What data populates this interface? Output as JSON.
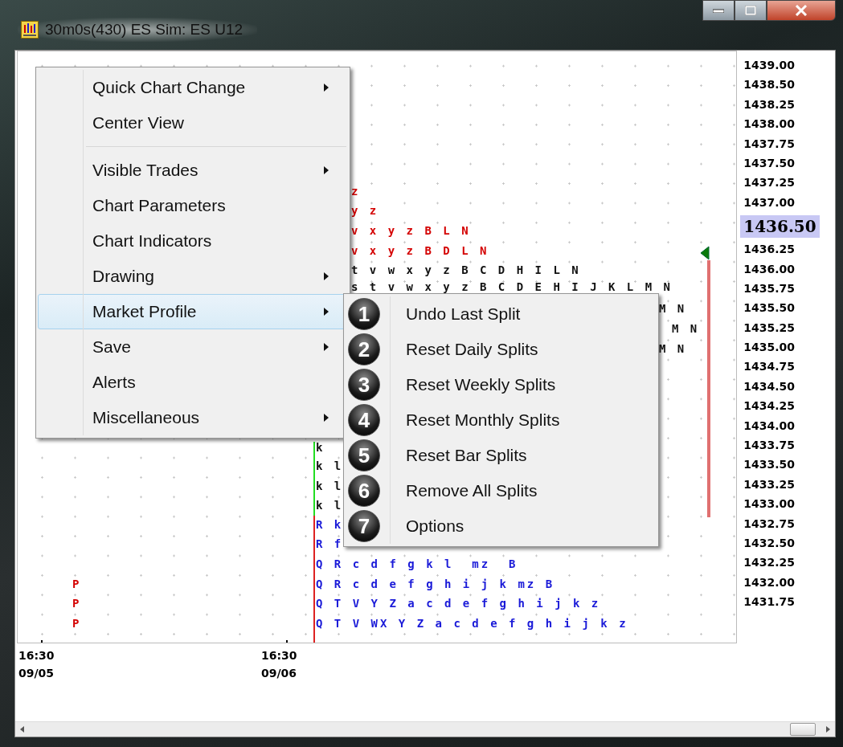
{
  "window": {
    "title": "30m0s(430) ES Sim: ES U12"
  },
  "profile_rows": [
    {
      "text": "z",
      "color": "#d40000"
    },
    {
      "text": "y z",
      "color": "#d40000"
    },
    {
      "text": "v x y z B L N",
      "color": "#d40000"
    },
    {
      "text": "v x y z B D L N",
      "color": "#d40000"
    },
    {
      "text": "t v w x y z B C D H I L N",
      "color": "#111111"
    },
    {
      "text": "s t v w x y z B C D E H I J K L M N",
      "color": "#111111"
    },
    {
      "text": "M N",
      "color": "#111111"
    },
    {
      "text": "M N",
      "color": "#111111"
    },
    {
      "text": "M N",
      "color": "#111111"
    },
    {
      "text": "k",
      "color": "#111111"
    },
    {
      "text": "k l",
      "color": "#111111"
    },
    {
      "text": "k l",
      "color": "#111111"
    },
    {
      "text": "k l",
      "color": "#111111"
    },
    {
      "text": "R k",
      "color": "#1a1ad8"
    },
    {
      "text": "R f",
      "color": "#1a1ad8"
    },
    {
      "text": "Q R c d f g k l  mz  B",
      "color": "#1a1ad8"
    },
    {
      "text": "Q R c d e f g h i j k mz B",
      "color": "#1a1ad8"
    },
    {
      "text": "Q T V Y Z a c d e f g h i j k z",
      "color": "#1a1ad8"
    },
    {
      "text": "Q T V WX Y Z a c d e f g h i j k z",
      "color": "#1a1ad8"
    },
    {
      "text": "P",
      "color": "#d40000"
    },
    {
      "text": "P",
      "color": "#d40000"
    },
    {
      "text": "P",
      "color": "#d40000"
    }
  ],
  "price_axis": [
    {
      "kind": "tick",
      "label": "1439.00"
    },
    {
      "kind": "tick",
      "label": "1438.50"
    },
    {
      "kind": "tick",
      "label": "1438.25"
    },
    {
      "kind": "tick",
      "label": "1438.00"
    },
    {
      "kind": "tick",
      "label": "1437.75"
    },
    {
      "kind": "tick",
      "label": "1437.50"
    },
    {
      "kind": "tick",
      "label": "1437.25"
    },
    {
      "kind": "tick",
      "label": "1437.00"
    },
    {
      "kind": "current",
      "label": "1436.50"
    },
    {
      "kind": "tick",
      "label": "1436.25"
    },
    {
      "kind": "tick",
      "label": "1436.00"
    },
    {
      "kind": "tick",
      "label": "1435.75"
    },
    {
      "kind": "tick",
      "label": "1435.50"
    },
    {
      "kind": "tick",
      "label": "1435.25"
    },
    {
      "kind": "tick",
      "label": "1435.00"
    },
    {
      "kind": "tick",
      "label": "1434.75"
    },
    {
      "kind": "tick",
      "label": "1434.50"
    },
    {
      "kind": "tick",
      "label": "1434.25"
    },
    {
      "kind": "tick",
      "label": "1434.00"
    },
    {
      "kind": "tick",
      "label": "1433.75"
    },
    {
      "kind": "tick",
      "label": "1433.50"
    },
    {
      "kind": "tick",
      "label": "1433.25"
    },
    {
      "kind": "tick",
      "label": "1433.00"
    },
    {
      "kind": "tick",
      "label": "1432.75"
    },
    {
      "kind": "tick",
      "label": "1432.50"
    },
    {
      "kind": "tick",
      "label": "1432.25"
    },
    {
      "kind": "tick",
      "label": "1432.00"
    },
    {
      "kind": "tick",
      "label": "1431.75"
    }
  ],
  "time_axis": [
    {
      "time": "16:30",
      "date": "09/05"
    },
    {
      "time": "16:30",
      "date": "09/06"
    }
  ],
  "context_menu": [
    {
      "kind": "item",
      "label": "Quick Chart Change",
      "has_submenu": true,
      "selected": false
    },
    {
      "kind": "item",
      "label": "Center View",
      "has_submenu": false,
      "selected": false
    },
    {
      "kind": "separator"
    },
    {
      "kind": "item",
      "label": "Visible Trades",
      "has_submenu": true,
      "selected": false
    },
    {
      "kind": "item",
      "label": "Chart Parameters",
      "has_submenu": false,
      "selected": false
    },
    {
      "kind": "item",
      "label": "Chart Indicators",
      "has_submenu": false,
      "selected": false
    },
    {
      "kind": "item",
      "label": "Drawing",
      "has_submenu": true,
      "selected": false
    },
    {
      "kind": "item",
      "label": "Market Profile",
      "has_submenu": true,
      "selected": true
    },
    {
      "kind": "item",
      "label": "Save",
      "has_submenu": true,
      "selected": false
    },
    {
      "kind": "item",
      "label": "Alerts",
      "has_submenu": false,
      "selected": false
    },
    {
      "kind": "item",
      "label": "Miscellaneous",
      "has_submenu": true,
      "selected": false
    }
  ],
  "submenu": [
    {
      "number": "1",
      "label": "Undo Last Split"
    },
    {
      "number": "2",
      "label": "Reset Daily Splits"
    },
    {
      "number": "3",
      "label": "Reset Weekly Splits"
    },
    {
      "number": "4",
      "label": "Reset Monthly Splits"
    },
    {
      "number": "5",
      "label": "Reset Bar Splits"
    },
    {
      "number": "6",
      "label": "Remove All Splits"
    },
    {
      "number": "7",
      "label": "Options"
    }
  ]
}
